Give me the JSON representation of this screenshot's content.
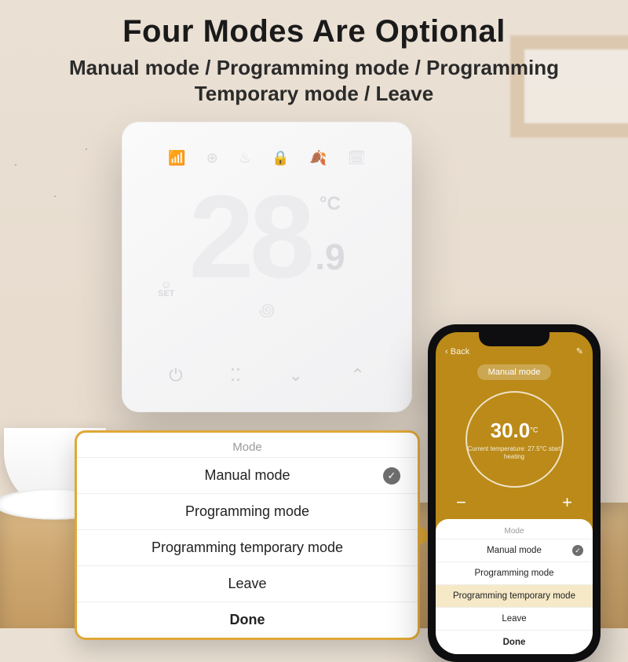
{
  "headline": "Four Modes Are Optional",
  "subhead": "Manual mode / Programming mode / Programming Temporary mode / Leave",
  "thermostat": {
    "set_label": "SET",
    "temp_main": "28",
    "temp_decimal": ".9",
    "temp_unit": "°C",
    "icons": {
      "wifi": "wifi-icon",
      "target": "target-icon",
      "flame": "flame-icon",
      "lock": "lock-icon",
      "leaf": "leaf-icon",
      "program": "program-icon",
      "heat": "heat-waves-icon"
    },
    "controls": {
      "power": "⏻",
      "menu": "⁚⁚",
      "down": "⌄",
      "up": "⌃"
    }
  },
  "mode_card": {
    "title": "Mode",
    "options": [
      {
        "label": "Manual mode",
        "selected": true
      },
      {
        "label": "Programming mode",
        "selected": false
      },
      {
        "label": "Programming temporary mode",
        "selected": false
      },
      {
        "label": "Leave",
        "selected": false
      }
    ],
    "done": "Done"
  },
  "phone": {
    "back": "Back",
    "edit": "✎",
    "mode_pill": "Manual mode",
    "dial_temp": "30.0",
    "dial_unit": "°C",
    "dial_sub": "Current temperature: 27.5°C\nstart heating",
    "minus": "−",
    "plus": "+",
    "sheet": {
      "title": "Mode",
      "options": [
        {
          "label": "Manual mode",
          "selected": true,
          "highlight": false
        },
        {
          "label": "Programming mode",
          "selected": false,
          "highlight": false
        },
        {
          "label": "Programming temporary mode",
          "selected": false,
          "highlight": true
        },
        {
          "label": "Leave",
          "selected": false,
          "highlight": false
        }
      ],
      "done": "Done"
    }
  }
}
